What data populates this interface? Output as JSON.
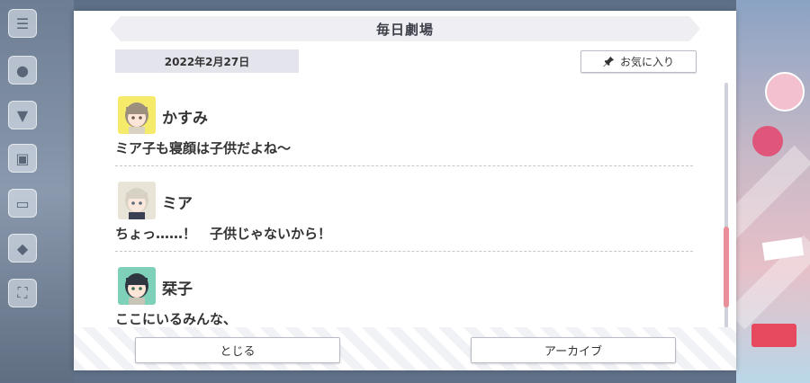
{
  "window": {
    "title": "毎日劇場"
  },
  "header": {
    "date": "2022年2月27日",
    "favorite_label": "お気に入り"
  },
  "entries": [
    {
      "name": "かすみ",
      "line": "ミア子も寝顔は子供だよね〜",
      "avatar_color": "#f5ea6a"
    },
    {
      "name": "ミア",
      "line": "ちょっ……！　子供じゃないから！",
      "avatar_color": "#e8e4d7"
    },
    {
      "name": "栞子",
      "line": "ここにいるみんな、",
      "avatar_color": "#7fd0b8"
    }
  ],
  "footer": {
    "close_label": "とじる",
    "archive_label": "アーカイブ"
  },
  "colors": {
    "accent": "#e88f9a",
    "title_bg": "#eeeef3",
    "date_bg": "#e4e5ec"
  }
}
